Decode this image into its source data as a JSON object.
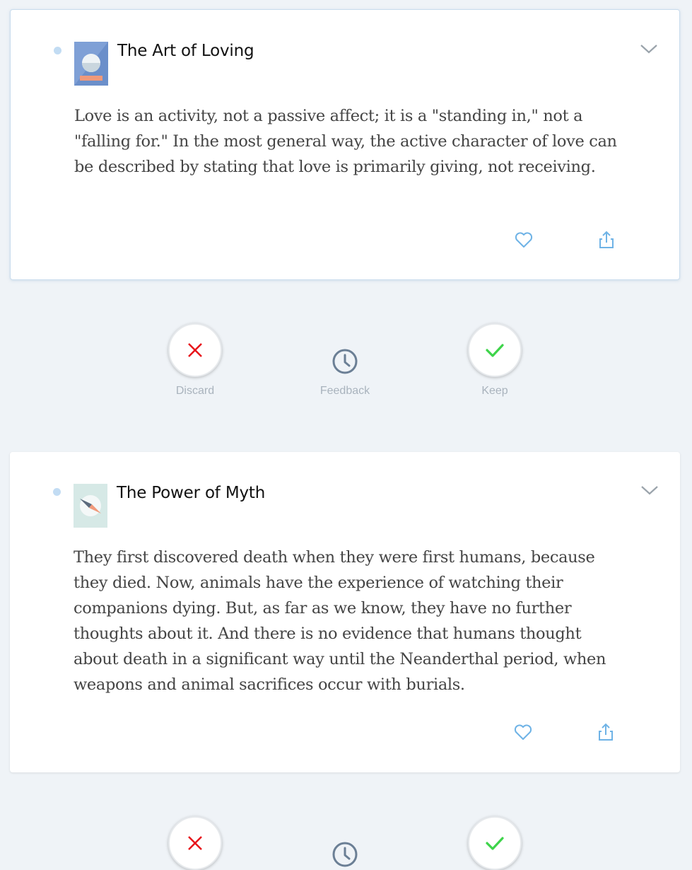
{
  "cards": [
    {
      "title": "The Art of Loving",
      "cover_icon": "crystal-ball-book-cover",
      "quote": "Love is an activity, not a passive affect; it is a \"standing in,\" not a \"falling for.\" In the most general way, the active character of love can be described by stating that love is primarily giving, not receiving."
    },
    {
      "title": "The Power of Myth",
      "cover_icon": "compass-book-cover",
      "quote": "They first discovered death when they were first humans, because they died. Now, animals have the experience of watching their companions dying. But, as far as we know, they have no further thoughts about it. And there is no evidence that humans thought about death in a significant way until the Neanderthal period, when weapons and animal sacrifices occur with burials."
    }
  ],
  "actions": {
    "discard_label": "Discard",
    "feedback_label": "Feedback",
    "keep_label": "Keep"
  },
  "colors": {
    "background": "#eff3f7",
    "accent_blue": "#6fb3e6",
    "discard_red": "#e8141c",
    "keep_green": "#3ed44a",
    "unread_dot": "#c2dcf3"
  }
}
